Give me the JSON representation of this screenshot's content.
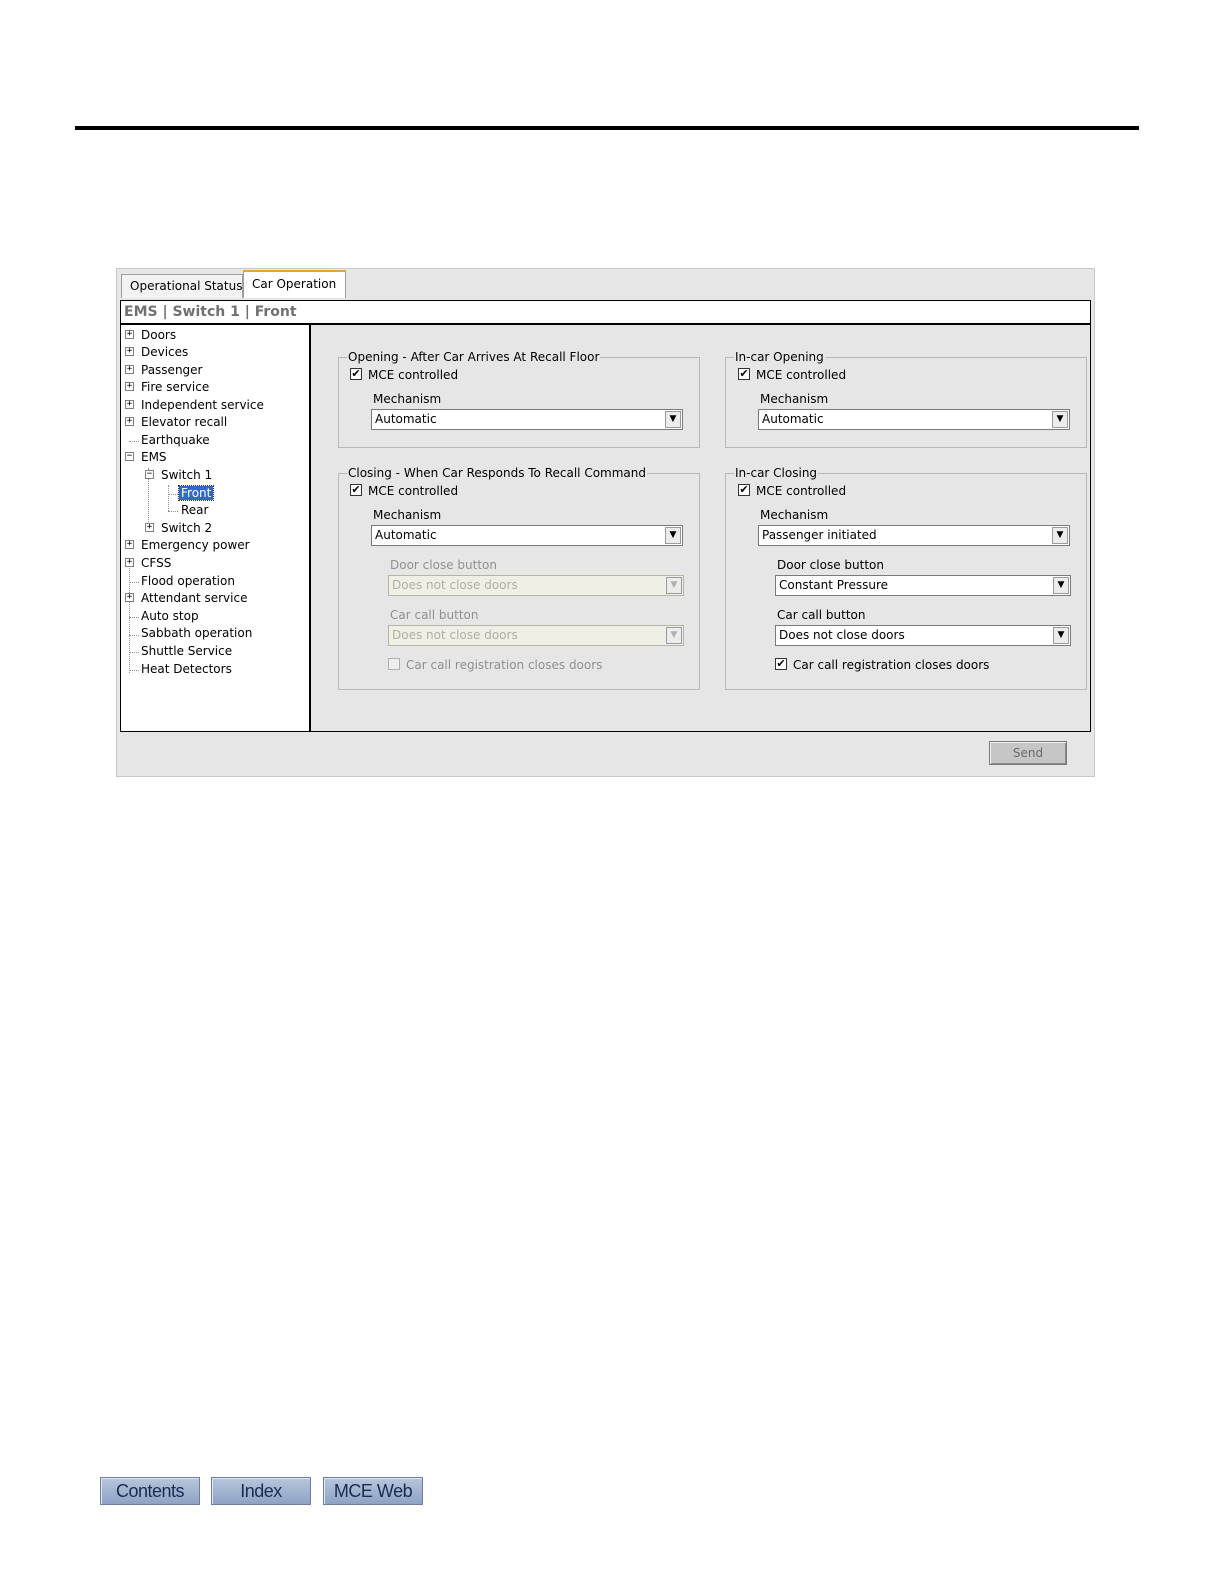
{
  "tabs": [
    "Operational Status",
    "Car Operation"
  ],
  "breadcrumb": "EMS | Switch 1 | Front",
  "tree": {
    "doors": "Doors",
    "devices": "Devices",
    "passenger": "Passenger",
    "fire_service": "Fire service",
    "independent_service": "Independent service",
    "elevator_recall": "Elevator recall",
    "earthquake": "Earthquake",
    "ems": "EMS",
    "switch1": "Switch 1",
    "front": "Front",
    "rear": "Rear",
    "switch2": "Switch 2",
    "emergency_power": "Emergency power",
    "cfss": "CFSS",
    "flood_operation": "Flood operation",
    "attendant_service": "Attendant service",
    "auto_stop": "Auto stop",
    "sabbath_operation": "Sabbath operation",
    "shuttle_service": "Shuttle Service",
    "heat_detectors": "Heat Detectors",
    "expand_glyph": "+",
    "collapse_glyph": "−"
  },
  "opening": {
    "legend": "Opening - After Car Arrives At Recall Floor",
    "mce_label": "MCE controlled",
    "mechanism_label": "Mechanism",
    "mechanism_value": "Automatic"
  },
  "incar_opening": {
    "legend": "In-car Opening",
    "mce_label": "MCE controlled",
    "mechanism_label": "Mechanism",
    "mechanism_value": "Automatic"
  },
  "closing": {
    "legend": "Closing - When Car Responds To Recall Command",
    "mce_label": "MCE controlled",
    "mechanism_label": "Mechanism",
    "mechanism_value": "Automatic",
    "door_close_label": "Door close button",
    "door_close_value": "Does not close doors",
    "car_call_label": "Car call button",
    "car_call_value": "Does not close doors",
    "registration_label": "Car call registration closes doors"
  },
  "incar_closing": {
    "legend": "In-car Closing",
    "mce_label": "MCE controlled",
    "mechanism_label": "Mechanism",
    "mechanism_value": "Passenger initiated",
    "door_close_label": "Door close button",
    "door_close_value": "Constant Pressure",
    "car_call_label": "Car call button",
    "car_call_value": "Does not close doors",
    "registration_label": "Car call registration closes doors"
  },
  "check_glyph": "✔",
  "dropdown_glyph": "▼",
  "send_label": "Send",
  "footer": {
    "contents": "Contents",
    "index": "Index",
    "mce_web": "MCE Web"
  }
}
